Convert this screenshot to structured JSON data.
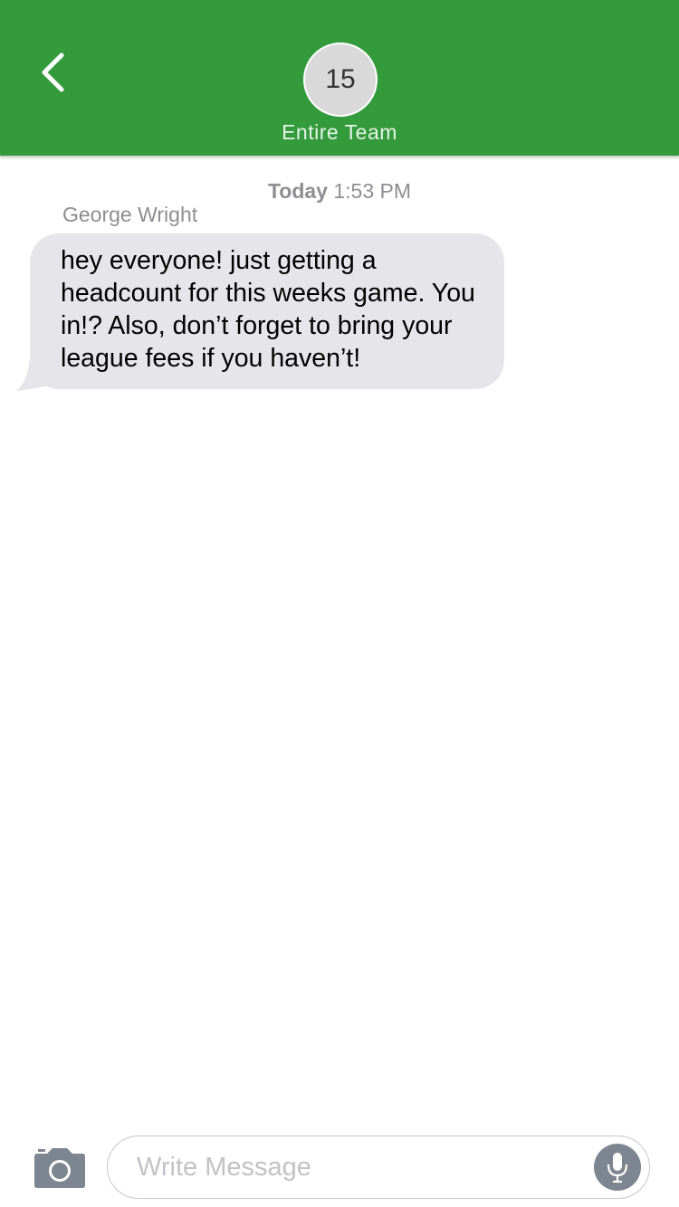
{
  "header": {
    "back_icon": "chevron-left-icon",
    "member_count": "15",
    "title": "Entire Team",
    "background_color": "#339b3c"
  },
  "conversation": {
    "timestamp_day": "Today",
    "timestamp_time": "1:53 PM",
    "messages": [
      {
        "sender": "George Wright",
        "text": "hey everyone! just getting a headcount for this weeks game. You in!? Also, don’t forget to bring your league fees if you haven’t!",
        "bubble_color": "#e5e5ea"
      }
    ]
  },
  "composer": {
    "camera_icon": "camera-icon",
    "placeholder": "Write Message",
    "mic_icon": "microphone-icon"
  }
}
